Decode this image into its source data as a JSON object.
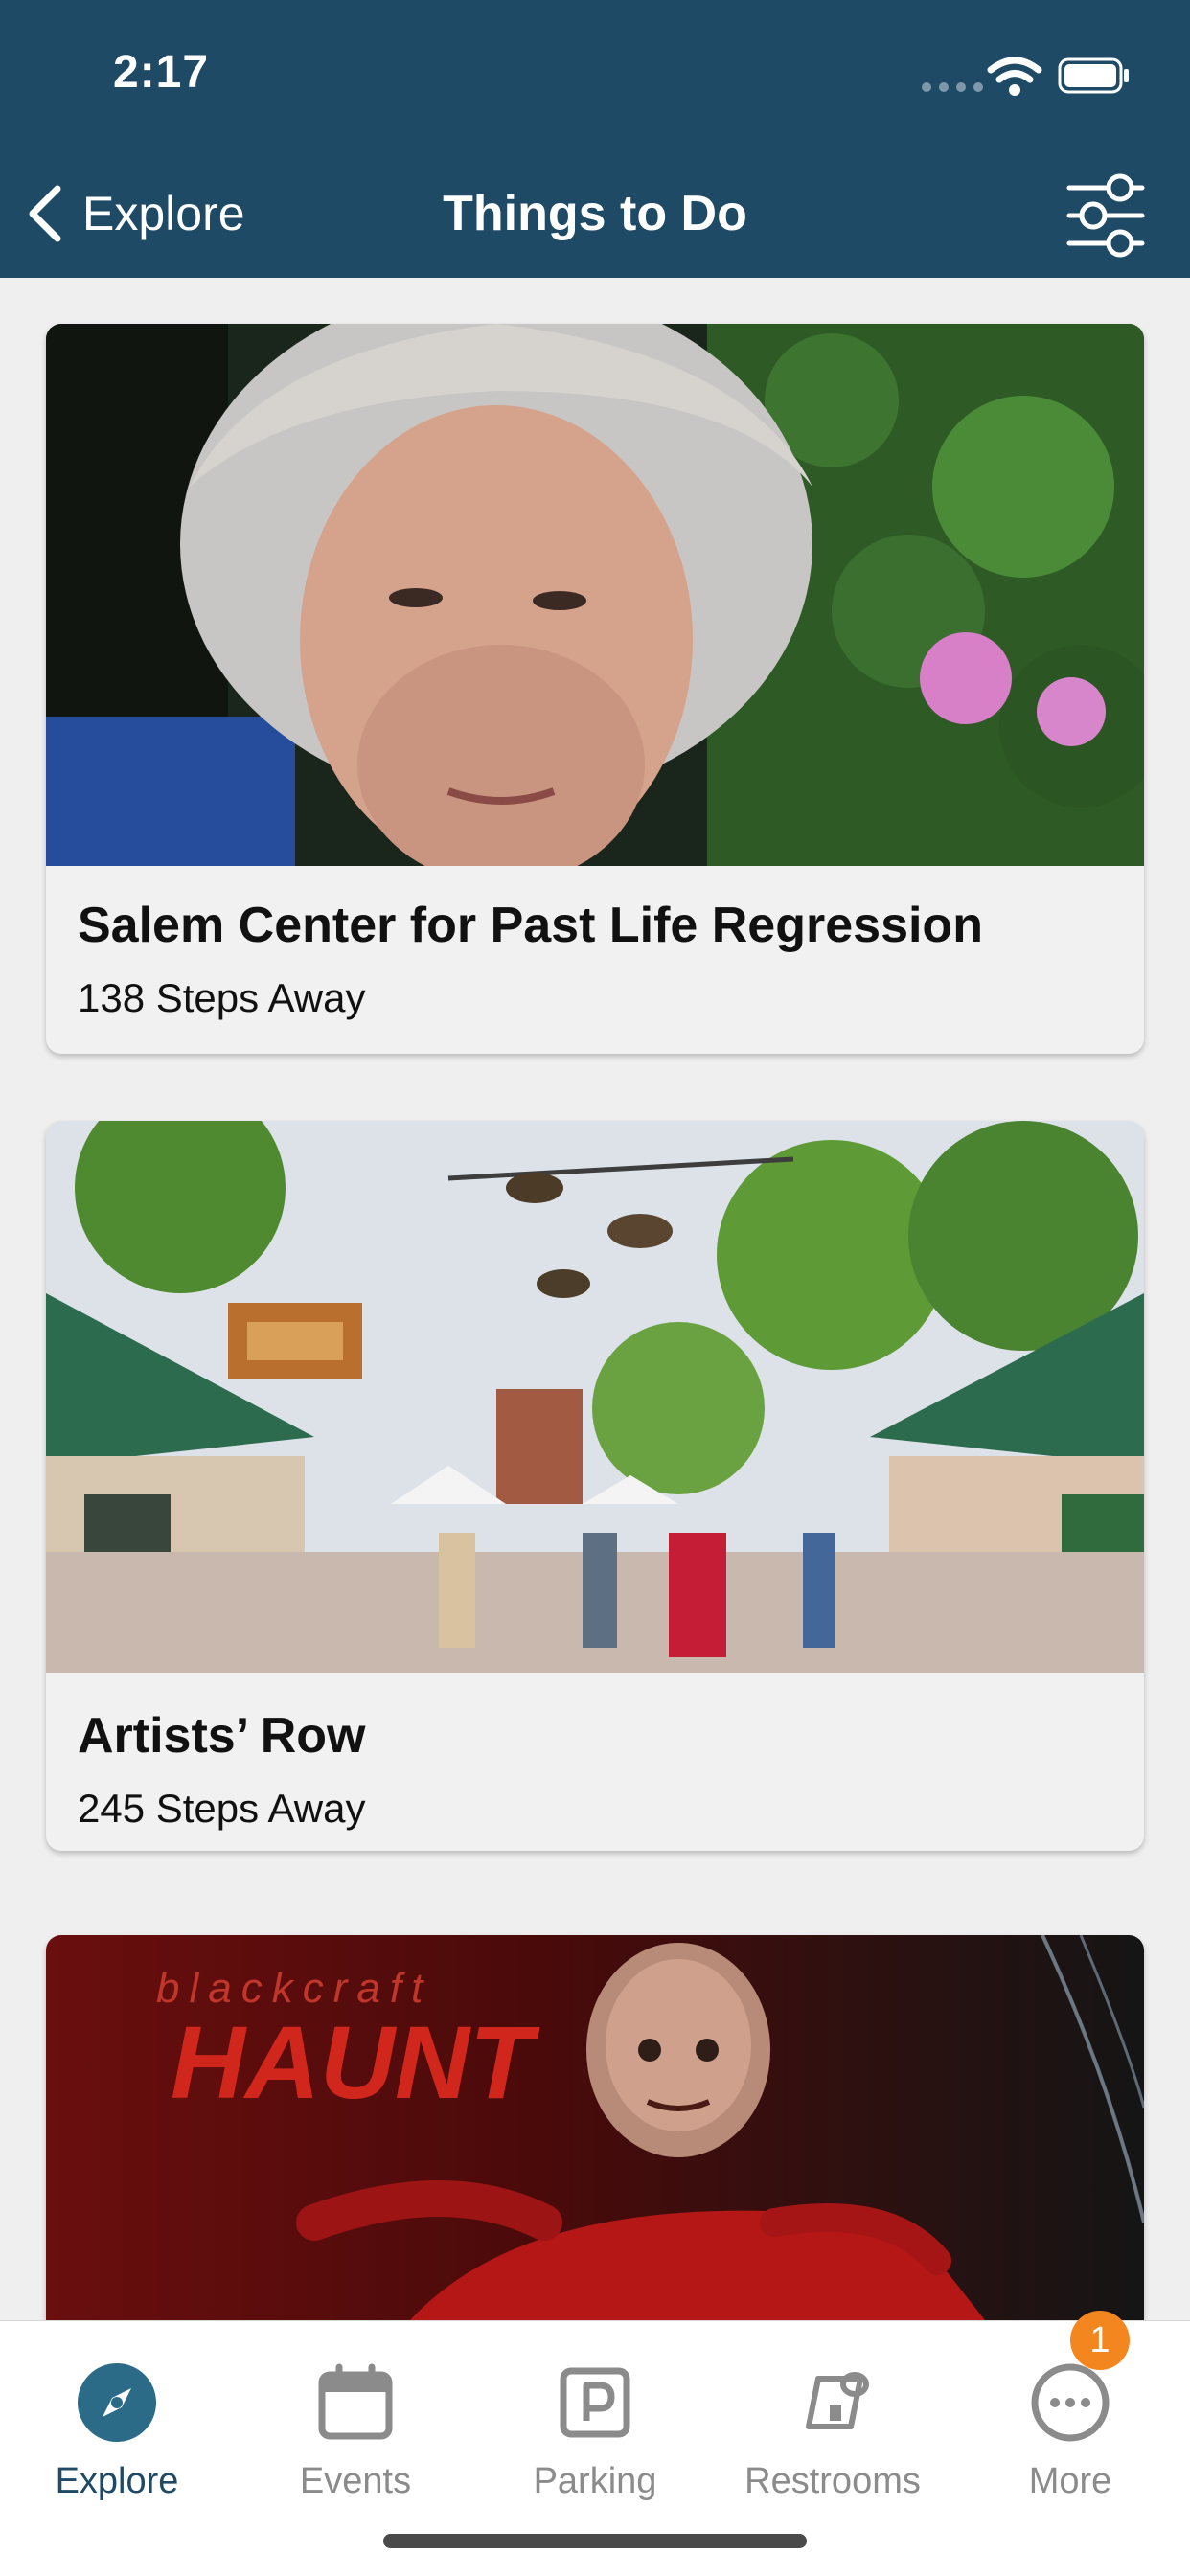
{
  "status_bar": {
    "time": "2:17"
  },
  "nav": {
    "back_label": "Explore",
    "title": "Things to Do"
  },
  "cards": [
    {
      "title": "Salem Center for Past Life Regression",
      "subtitle": "138 Steps Away"
    },
    {
      "title": "Artists’ Row",
      "subtitle": "245 Steps Away"
    },
    {
      "logo_text_1": "blackcraft",
      "logo_text_2": "HAUNT"
    }
  ],
  "tabs": [
    {
      "label": "Explore",
      "icon": "compass-icon",
      "active": true
    },
    {
      "label": "Events",
      "icon": "calendar-icon"
    },
    {
      "label": "Parking",
      "icon": "parking-icon"
    },
    {
      "label": "Restrooms",
      "icon": "toilet-paper-icon"
    },
    {
      "label": "More",
      "icon": "more-icon",
      "badge": "1"
    }
  ],
  "colors": {
    "header": "#1e4a66",
    "accent": "#2c6b87",
    "badge": "#f4861f"
  }
}
